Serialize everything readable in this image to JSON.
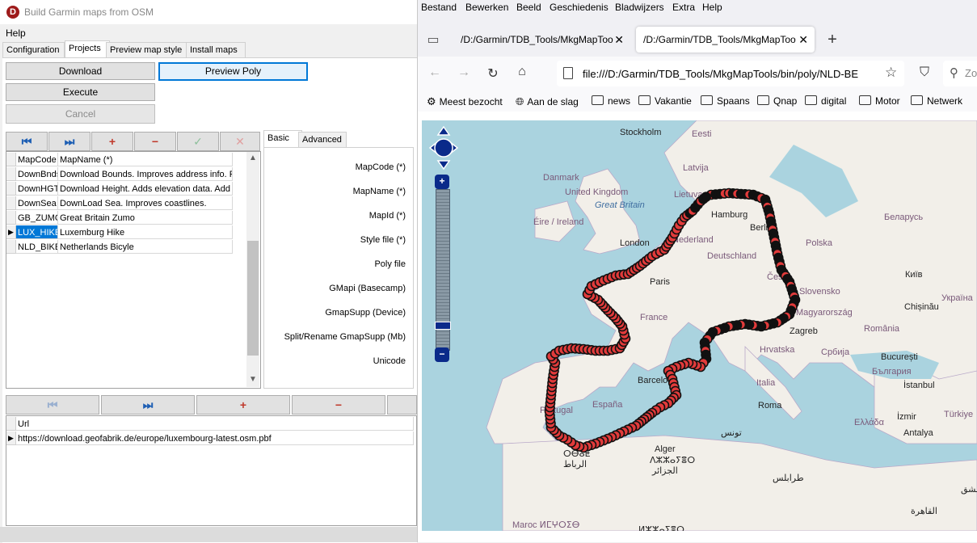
{
  "app": {
    "title": "Build Garmin maps from OSM",
    "logo_letter": "D",
    "menu": "Help",
    "tabs": [
      "Configuration",
      "Projects",
      "Preview map style",
      "Install maps"
    ],
    "active_tab": "Projects",
    "buttons": {
      "download": "Download",
      "preview_poly": "Preview Poly",
      "execute": "Execute",
      "cancel": "Cancel"
    },
    "projects_grid": {
      "columns": [
        "MapCode",
        "MapName (*)"
      ],
      "rows": [
        [
          "DownBnds",
          "Download Bounds. Improves address info. R"
        ],
        [
          "DownHGT",
          "Download Height. Adds elevation data. Add"
        ],
        [
          "DownSea",
          "DownLoad Sea. Improves coastlines."
        ],
        [
          "GB_ZUMO",
          "Great Britain Zumo"
        ],
        [
          "LUX_HIKE",
          "Luxemburg Hike"
        ],
        [
          "NLD_BIKE",
          "Netherlands Bicyle"
        ]
      ],
      "selected_row": 4
    },
    "detail_tabs": [
      "Basic",
      "Advanced"
    ],
    "detail_active": "Basic",
    "form_labels": [
      "MapCode (*)",
      "MapName (*)",
      "MapId (*)",
      "Style file (*)",
      "Poly file",
      "GMapi (Basecamp)",
      "GmapSupp (Device)",
      "Split/Rename GmapSupp (Mb)",
      "Unicode"
    ],
    "url_grid": {
      "column": "Url",
      "rows": [
        "https://download.geofabrik.de/europe/luxembourg-latest.osm.pbf"
      ]
    },
    "colors": {
      "accent": "#0078d7",
      "nav_red": "#c0392b",
      "nav_green": "#2e8b57",
      "nav_blue": "#1e5fb4"
    }
  },
  "browser": {
    "menu": [
      "Bestand",
      "Bewerken",
      "Beeld",
      "Geschiedenis",
      "Bladwijzers",
      "Extra",
      "Help"
    ],
    "tabs": [
      {
        "title": "/D:/Garmin/TDB_Tools/MkgMapToo"
      },
      {
        "title": "/D:/Garmin/TDB_Tools/MkgMapToo"
      }
    ],
    "active_tab": 1,
    "url": "file:///D:/Garmin/TDB_Tools/MkgMapTools/bin/poly/NLD-BE",
    "search_placeholder": "Zo",
    "bookmarks": [
      {
        "label": "Meest bezocht",
        "icon": "gear-icon"
      },
      {
        "label": "Aan de slag",
        "icon": "globe-icon"
      },
      {
        "label": "news",
        "icon": "folder-icon"
      },
      {
        "label": "Vakantie",
        "icon": "folder-icon"
      },
      {
        "label": "Spaans",
        "icon": "folder-icon"
      },
      {
        "label": "Qnap",
        "icon": "folder-icon"
      },
      {
        "label": "digital",
        "icon": "folder-icon"
      },
      {
        "label": "Motor",
        "icon": "folder-icon"
      },
      {
        "label": "Netwerk",
        "icon": "folder-icon"
      }
    ],
    "map": {
      "labels": {
        "stockholm": "Stockholm",
        "eesti": "Eesti",
        "danmark": "Danmark",
        "latvija": "Latvija",
        "united_kingdom": "United Kingdom",
        "great_britain": "Great Britain",
        "lietuva": "Lietuva",
        "eire": "Éire / Ireland",
        "hamburg": "Hamburg",
        "belarus": "Беларусь",
        "berlin": "Berlin",
        "nederland": "Nederland",
        "london": "London",
        "deutschland": "Deutschland",
        "polska": "Polska",
        "kyiv": "Київ",
        "paris": "Paris",
        "cesko": "Česko",
        "slovensko": "Slovensko",
        "chisinau": "Chișinău",
        "ukraine": "Україна",
        "france": "France",
        "magyarorszag": "Magyarország",
        "zagreb": "Zagreb",
        "romania": "România",
        "hrvatska": "Hrvatska",
        "srbija": "Србија",
        "bucuresti": "București",
        "bulgaria": "България",
        "italia": "Italia",
        "roma": "Roma",
        "istanbul": "İstanbul",
        "barcelona": "Barcelona",
        "espana": "España",
        "portugal": "Portugal",
        "izmir": "İzmir",
        "turkiye": "Türkiye",
        "ellada": "Ελλάδα",
        "antalya": "Antalya",
        "tunis": "تونس",
        "alger": "Alger",
        "alger_tifinagh": "ⴷⵣⵣⴰⵢⴻⵔ",
        "alger_ar": "الجزائر",
        "rabat_tif": "ⵔⴱⴰⵟ",
        "rabat_ar": "الرباط",
        "maroc": "Maroc ⵍⵎⵖⵔⵉⴱ",
        "tripoli": "طرابلس",
        "dimashq": "دمشق",
        "cairo": "القاهرة",
        "bottom_tif": "ⵍⵣⵣⴰⵢⴻⵔ"
      }
    }
  }
}
